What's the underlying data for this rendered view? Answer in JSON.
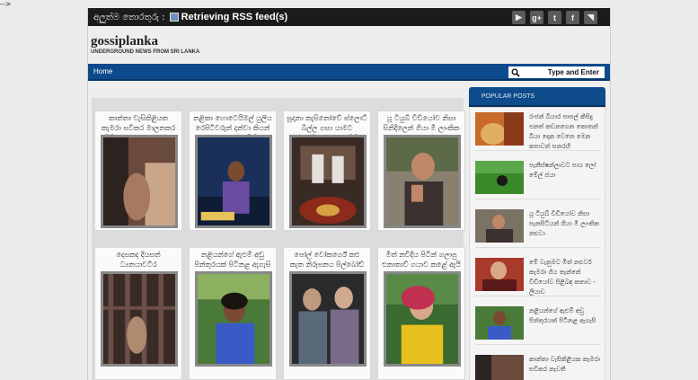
{
  "stray_text": "-->",
  "topbar": {
    "ticker_label": "අලුත්ම තොරතුරු :",
    "ticker_text": "Retrieving RSS feed(s)",
    "social": [
      {
        "name": "youtube-icon",
        "glyph": "▶"
      },
      {
        "name": "google-plus-icon",
        "glyph": "g+"
      },
      {
        "name": "twitter-icon",
        "glyph": "t"
      },
      {
        "name": "facebook-icon",
        "glyph": "f"
      },
      {
        "name": "rss-icon",
        "glyph": "◥"
      }
    ]
  },
  "header": {
    "logo": "gossiplanka",
    "tagline": "UNDERGROUND NEWS FROM SRI LANKA"
  },
  "nav": {
    "home": "Home",
    "search_value": "Type and Enter"
  },
  "posts": [
    {
      "title": "කාන්තා වැසිකිළියක කැමරා සවිකර මාලනකර වීඩියෝ කැමරා පවත්ව"
    },
    {
      "title": "නළිකා හොටෙයිමල් යුලිය රෙපිටිවරුන් දන්වා කියන් කරුණු දන්ව සිති"
    },
    {
      "title": "සූදානා කැසිනෝවේ ස්ලොට් බිල්ල ගසා යාමට ඉල්ලන්දිය රජු කොනිගිල කරේ"
    },
    {
      "title": "යූ ටියුබ් වීඩියෝව නිසා සිනිදිලෙන් ගියා මී ලාංකික කරුවෝ"
    },
    {
      "title": "දෙසකද දියසත් ධ්‍යනයාවටිර"
    },
    {
      "title": "නළියන්ගේ ඇළුම් අඩු පින්තුරයක් පිටිනළ ඇගැසි"
    },
    {
      "title": "පෝල් වෝකර්ගේ කළු කැත නිරූපනය පිල්බෝඩ් ලොඩයට"
    },
    {
      "title": "මිත් නවීදිය පිටින් ගලාපු එනාතාව් ගයාව කළේ ඇයි"
    }
  ],
  "sidebar": {
    "title": "POPULAR POSTS",
    "items": [
      {
        "text": "රංජන් බියාර පාසල් කිසිදු පනත් කඩනගෙන කොතන් බියා දොක වෙනෙ මෙන කපාවත් සනරහි"
      },
      {
        "text": "පැනීස්ෂන්ලාවට පාය ලෝ මේල් ජයා"
      },
      {
        "text": "යූ ටියුබ් වීඩියෝව නිසා පැනසිටියන් ගියා මී ලාංකික නළුවා"
      },
      {
        "text": "මේ වැනුමට මිත් නළුවර් කැමරා ගිය තැන්නේ වීඩියෝව පිළිබඳ කතාව - ලියාව"
      },
      {
        "text": "නළියන්ගේ ඇළුම් අඩු පින්තුරයක් පිටිනළ ඇගැසි"
      },
      {
        "text": "කාන්තා වැසිකිළියක කැමරා සවිකර නැවතී"
      }
    ]
  }
}
